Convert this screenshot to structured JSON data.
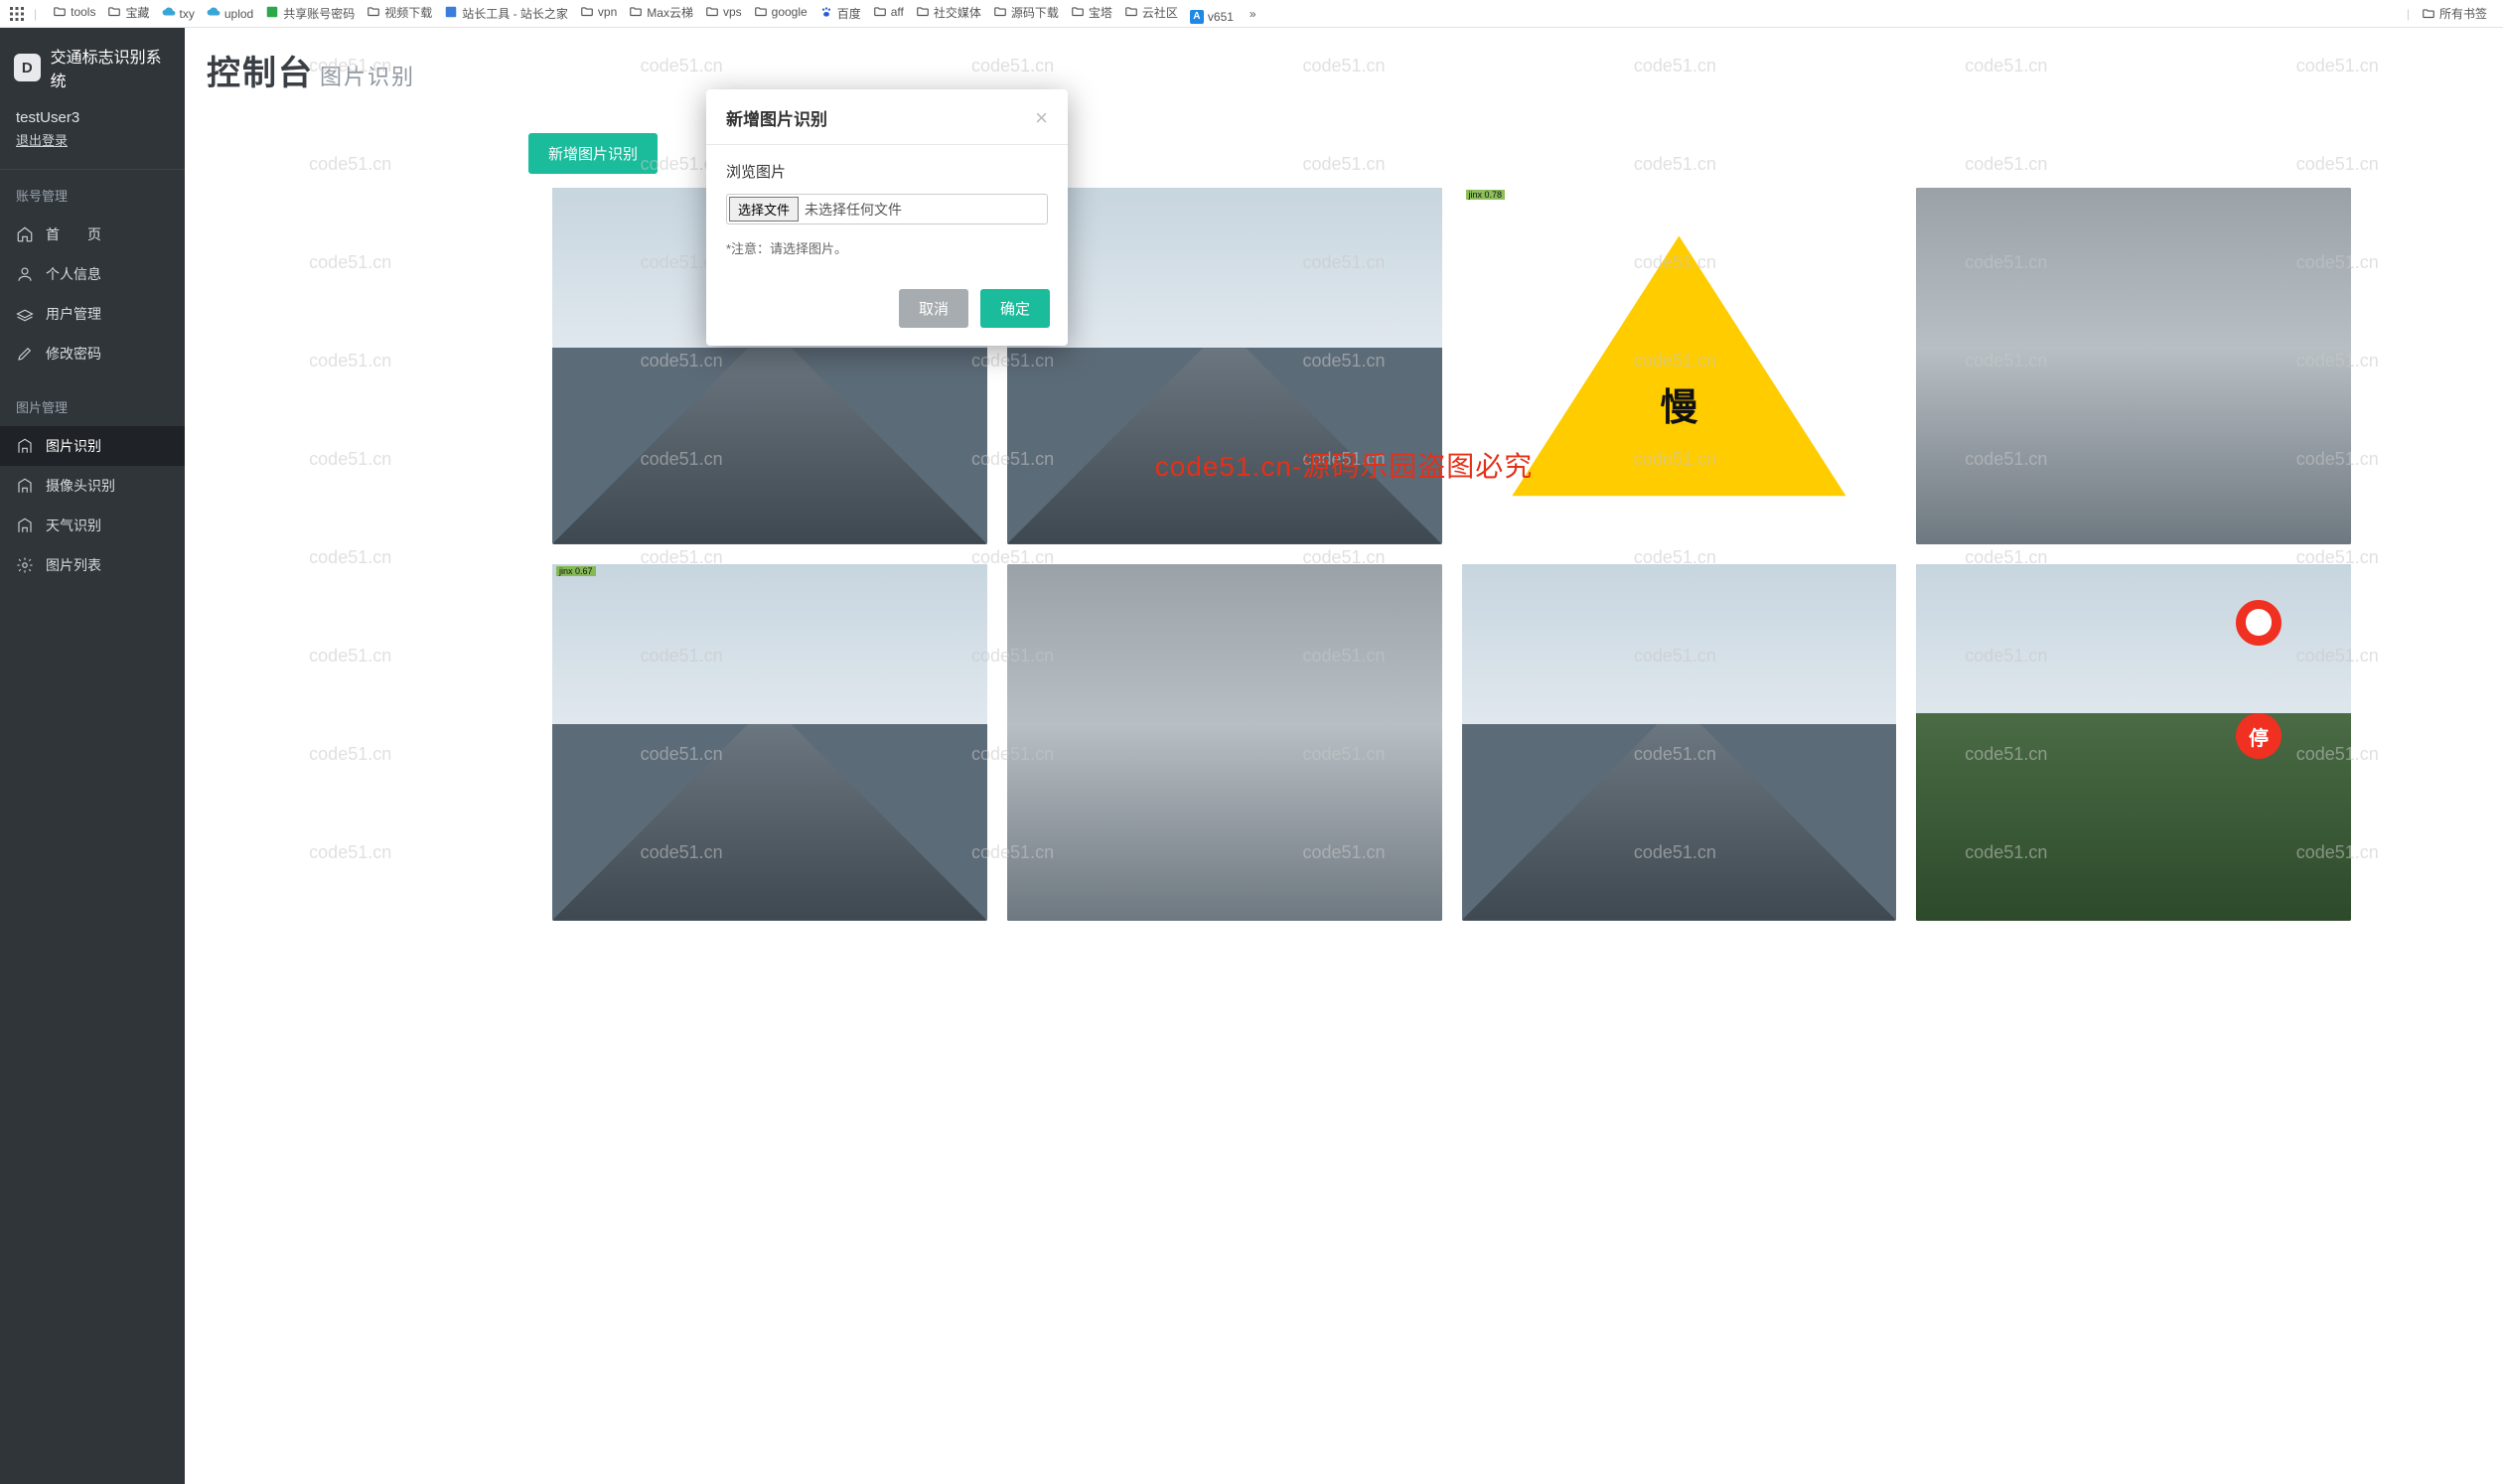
{
  "bookmarks": {
    "items": [
      {
        "label": "tools",
        "icon": "folder"
      },
      {
        "label": "宝藏",
        "icon": "folder"
      },
      {
        "label": "txy",
        "icon": "cloud"
      },
      {
        "label": "uplod",
        "icon": "cloud"
      },
      {
        "label": "共享账号密码",
        "icon": "green"
      },
      {
        "label": "视频下载",
        "icon": "folder"
      },
      {
        "label": "站长工具 - 站长之家",
        "icon": "blue"
      },
      {
        "label": "vpn",
        "icon": "folder"
      },
      {
        "label": "Max云梯",
        "icon": "folder"
      },
      {
        "label": "vps",
        "icon": "folder"
      },
      {
        "label": "google",
        "icon": "folder"
      },
      {
        "label": "百度",
        "icon": "paw"
      },
      {
        "label": "aff",
        "icon": "folder"
      },
      {
        "label": "社交媒体",
        "icon": "folder"
      },
      {
        "label": "源码下载",
        "icon": "folder"
      },
      {
        "label": "宝塔",
        "icon": "folder"
      },
      {
        "label": "云社区",
        "icon": "folder"
      },
      {
        "label": "v651",
        "icon": "A"
      }
    ],
    "more": "»",
    "right_label": "所有书签"
  },
  "sidebar": {
    "logo_text": "D",
    "app_name": "交通标志识别系统",
    "username": "testUser3",
    "logout": "退出登录",
    "sections": {
      "account": "账号管理",
      "image": "图片管理"
    },
    "menu_account": [
      {
        "label": "首　　页"
      },
      {
        "label": "个人信息"
      },
      {
        "label": "用户管理"
      },
      {
        "label": "修改密码"
      }
    ],
    "menu_image": [
      {
        "label": "图片识别",
        "active": true
      },
      {
        "label": "摄像头识别"
      },
      {
        "label": "天气识别"
      },
      {
        "label": "图片列表"
      }
    ]
  },
  "page": {
    "title_main": "控制台",
    "title_sub": "图片识别",
    "add_button": "新增图片识别"
  },
  "modal": {
    "title": "新增图片识别",
    "browse_label": "浏览图片",
    "choose_file_btn": "选择文件",
    "no_file_text": "未选择任何文件",
    "note": "*注意：请选择图片。",
    "cancel": "取消",
    "ok": "确定"
  },
  "grid": {
    "cells": [
      {
        "type": "road",
        "label": ""
      },
      {
        "type": "road",
        "label": ""
      },
      {
        "type": "warn",
        "label": "jinx 0.78",
        "text": "慢"
      },
      {
        "type": "rain",
        "label": ""
      },
      {
        "type": "road",
        "label": "jinx 0.67"
      },
      {
        "type": "rain",
        "label": ""
      },
      {
        "type": "road",
        "label": ""
      },
      {
        "type": "signs",
        "label": "",
        "stop_text": "停"
      }
    ]
  },
  "watermark": {
    "text": "code51.cn",
    "center": "code51.cn-源码乐园盗图必究"
  }
}
